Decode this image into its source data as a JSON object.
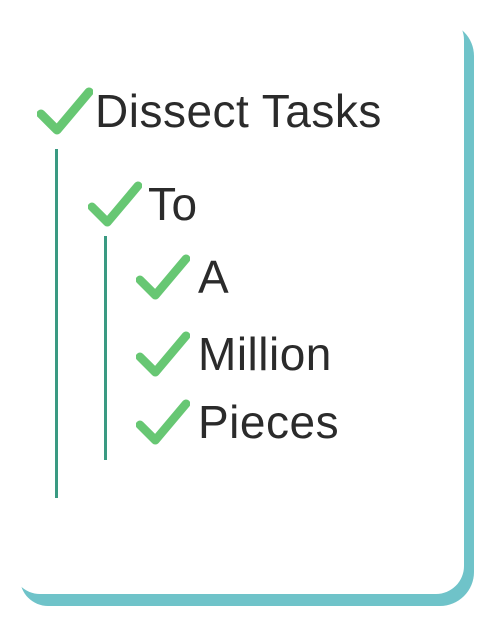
{
  "colors": {
    "teal": "#6fc3c9",
    "check_green": "#67c773",
    "rail": "#3a9a82",
    "text": "#2b2b2b",
    "card": "#ffffff"
  },
  "icons": {
    "check": "check-icon"
  },
  "items": [
    {
      "label": "Dissect Tasks",
      "level": 1
    },
    {
      "label": "To",
      "level": 2
    },
    {
      "label": "A",
      "level": 3
    },
    {
      "label": "Million",
      "level": 3
    },
    {
      "label": "Pieces",
      "level": 3
    }
  ]
}
